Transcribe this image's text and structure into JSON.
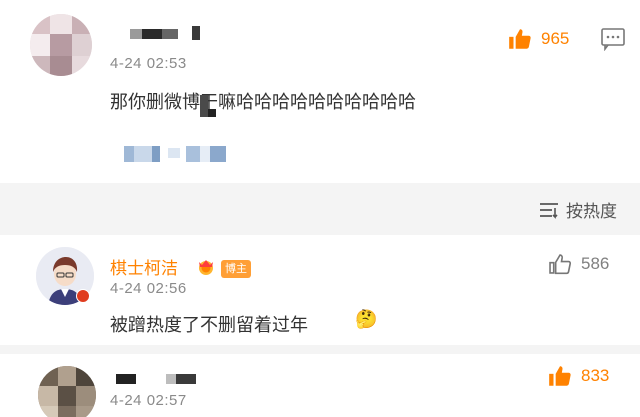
{
  "comments": [
    {
      "username": "",
      "time": "4-24 02:53",
      "text": "那你删微博干嘛哈哈哈哈哈哈哈哈哈哈",
      "likes": "965",
      "liked": true,
      "reply_quote": ""
    },
    {
      "username": "棋士柯洁",
      "time": "4-24 02:56",
      "text": "被蹭热度了不删留着过年",
      "emoji": "🤔",
      "likes": "586",
      "liked": false,
      "badge": "博主"
    },
    {
      "username": "",
      "time": "4-24 02:57",
      "likes": "833",
      "liked": true
    }
  ],
  "sort": {
    "label": "按热度",
    "icon": "sort-lines-icon"
  },
  "colors": {
    "accent": "#ff8200",
    "badge": "#ff9f36",
    "muted": "#8a8a8a",
    "divider": "#f4f4f4"
  }
}
